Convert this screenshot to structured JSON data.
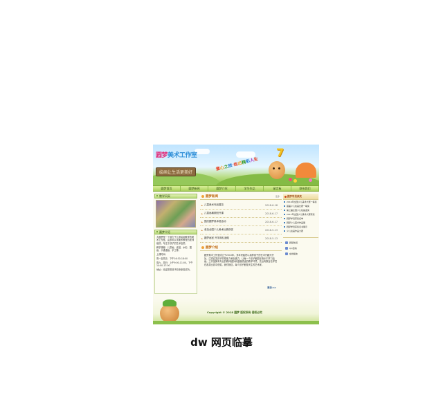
{
  "banner": {
    "logo_part1": "圆梦",
    "logo_part2": "美术工作室",
    "slogan": "绘画让生活更美好",
    "rainbow_text": [
      "童",
      "心",
      "之",
      "旅",
      "·",
      "绘",
      "出",
      "精",
      "彩",
      "人",
      "生"
    ],
    "seven": "7"
  },
  "nav": {
    "items": [
      "圆梦首页",
      "圆梦新闻",
      "圆梦介绍",
      "学生作品",
      "留言板",
      "联系我们"
    ]
  },
  "left": {
    "photo_title": "教学风采",
    "intro_title": "圆梦介绍",
    "intro_paragraphs": [
      "大圆梦是一个致力于儿童绘画教学的美术工作室，由多年从事美术教育的老师组成，专注于孩子的艺术启蒙。",
      "教学课程：儿童画、素描、水彩、国画、卡通漫画、手工等。",
      "上课时间：",
      "周一至周五：下午16:30-18:00",
      "周六、周日：上午9:00-11:00，下午14:00-17:00",
      "地址：欢迎您带孩子前来参观试听。"
    ]
  },
  "center": {
    "news_title": "圆梦新闻",
    "news_more": "更多",
    "news": [
      {
        "title": "儿童美术作品展览",
        "date": "2018-6-18"
      },
      {
        "title": "儿童画暑期班开课",
        "date": "2018-6-17"
      },
      {
        "title": "国庆圆梦美术馆活动",
        "date": "2018-6-17"
      },
      {
        "title": "参加全国少儿美术比赛获奖",
        "date": "2018-5-13"
      },
      {
        "title": "圆梦画室 开学典礼通知",
        "date": "2018-5-13"
      }
    ],
    "intro_title": "圆梦介绍",
    "intro_text": "圆梦美术工作室成立于2010年，多年来始终以培养孩子的艺术兴趣为宗旨，注重启发孩子的想象力和创造力，让每一个孩子都能在快乐中学习绘画。工作室拥有专业的教师团队和温馨舒适的教学环境，先后有数百名学员在各类比赛中获奖。我们相信，每个孩子都是天生的艺术家。",
    "more_link": "更多>>"
  },
  "right": {
    "title": "圆梦学员获奖",
    "items": [
      "2016年全国少儿美术大赛一等奖",
      "首届少儿绘画比赛一等奖",
      "第三届全国少儿绘画金奖",
      "2017年全国少儿美术大赛获奖",
      "圆梦学员获奖名单",
      "圆梦少儿美术作品展",
      "圆梦学员获奖证书展示",
      "少儿绘画作品大赛"
    ],
    "links": [
      "圆梦新闻",
      "QQ咨询",
      "在线留言"
    ]
  },
  "footer": {
    "copyright": "Copyright © 2018 圆梦 版权所有 侵权必究"
  },
  "caption": "dw 网页临摹"
}
